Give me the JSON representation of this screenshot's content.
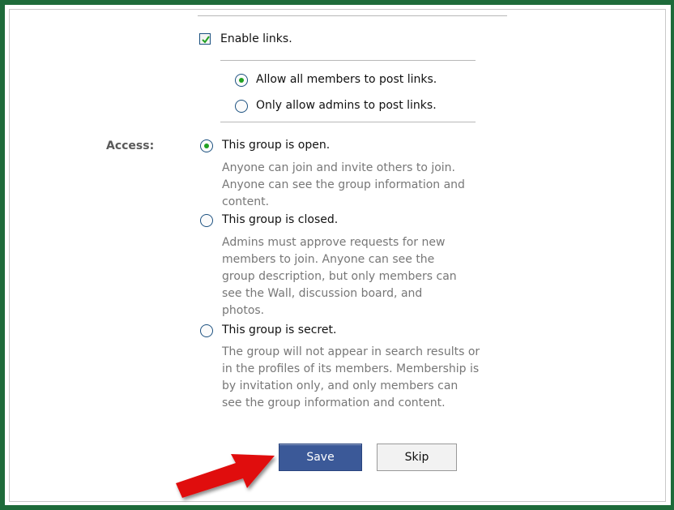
{
  "links": {
    "enable_label": "Enable links.",
    "enabled": true,
    "options": [
      {
        "label": "Allow all members to post links.",
        "selected": true
      },
      {
        "label": "Only allow admins to post links.",
        "selected": false
      }
    ]
  },
  "access": {
    "label": "Access:",
    "options": [
      {
        "label": "This group is open.",
        "selected": true,
        "description": "Anyone can join and invite others to join. Anyone can see the group information and content."
      },
      {
        "label": "This group is closed.",
        "selected": false,
        "description": "Admins must approve requests for new members to join. Anyone can see the group description, but only members can see the Wall, discussion board, and photos."
      },
      {
        "label": "This group is secret.",
        "selected": false,
        "description": "The group will not appear in search results or in the profiles of its members. Membership is by invitation only, and only members can see the group information and content."
      }
    ]
  },
  "actions": {
    "save_label": "Save",
    "skip_label": "Skip"
  },
  "colors": {
    "frame": "#1e6b3a",
    "save_button": "#3b5998",
    "annotation_arrow": "#e01010",
    "radio_selected": "#21a121"
  }
}
